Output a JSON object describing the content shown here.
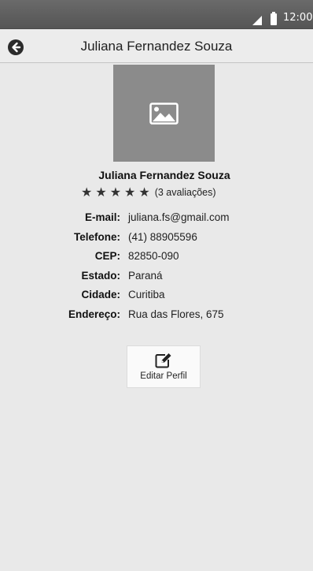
{
  "status_bar": {
    "time": "12:00",
    "icons": [
      "signal-icon",
      "battery-icon"
    ]
  },
  "header": {
    "title": "Juliana Fernandez Souza",
    "back_icon": "back-arrow-icon"
  },
  "profile": {
    "photo_icon": "image-placeholder-icon",
    "name": "Juliana Fernandez Souza",
    "rating": {
      "stars": 5,
      "max_stars": 5,
      "count_text": "(3 avaliações)"
    }
  },
  "info": [
    {
      "label": "E-mail:",
      "value": "juliana.fs@gmail.com"
    },
    {
      "label": "Telefone:",
      "value": "(41) 88905596"
    },
    {
      "label": "CEP:",
      "value": "82850-090"
    },
    {
      "label": "Estado:",
      "value": "Paraná"
    },
    {
      "label": "Cidade:",
      "value": "Curitiba"
    },
    {
      "label": "Endereço:",
      "value": "Rua das Flores, 675"
    }
  ],
  "edit_button": {
    "label": "Editar Perfil",
    "icon": "edit-icon"
  },
  "colors": {
    "status_bar": "#5e5e5e",
    "header_bg": "#ececec",
    "page_bg": "#e9e9e9",
    "avatar_bg": "#8b8b8b"
  }
}
